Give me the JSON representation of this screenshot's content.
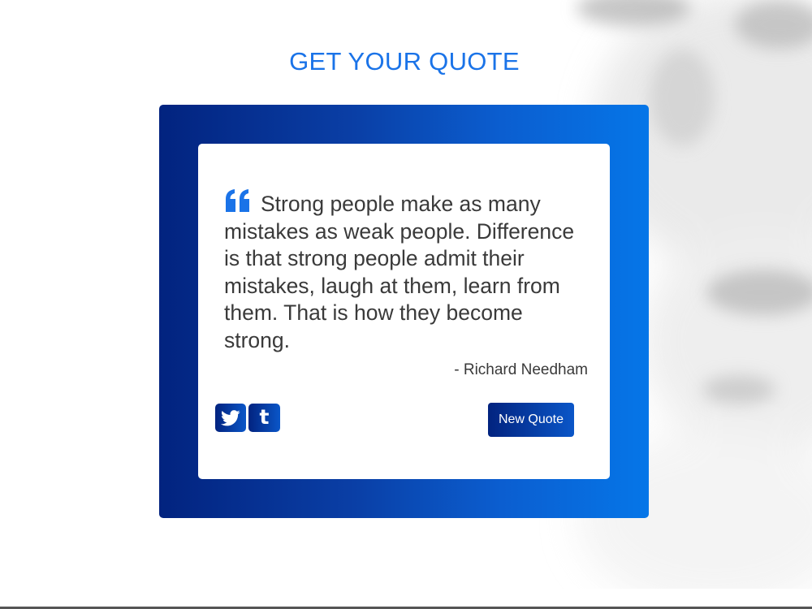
{
  "header": {
    "title": "GET YOUR QUOTE"
  },
  "quote": {
    "text": "Strong people make as many mistakes as weak people. Difference is that strong people admit their mistakes, laugh at them, learn from them. That is how they become strong.",
    "author": "- Richard Needham",
    "open_quote_icon": "quote-left-icon"
  },
  "actions": {
    "twitter_icon": "twitter-icon",
    "tumblr_icon": "tumblr-icon",
    "new_quote_label": "New Quote"
  },
  "colors": {
    "accent": "#1a73e8",
    "gradient_start": "#02237f",
    "gradient_end": "#0576e8",
    "text": "#3a3a3a"
  }
}
